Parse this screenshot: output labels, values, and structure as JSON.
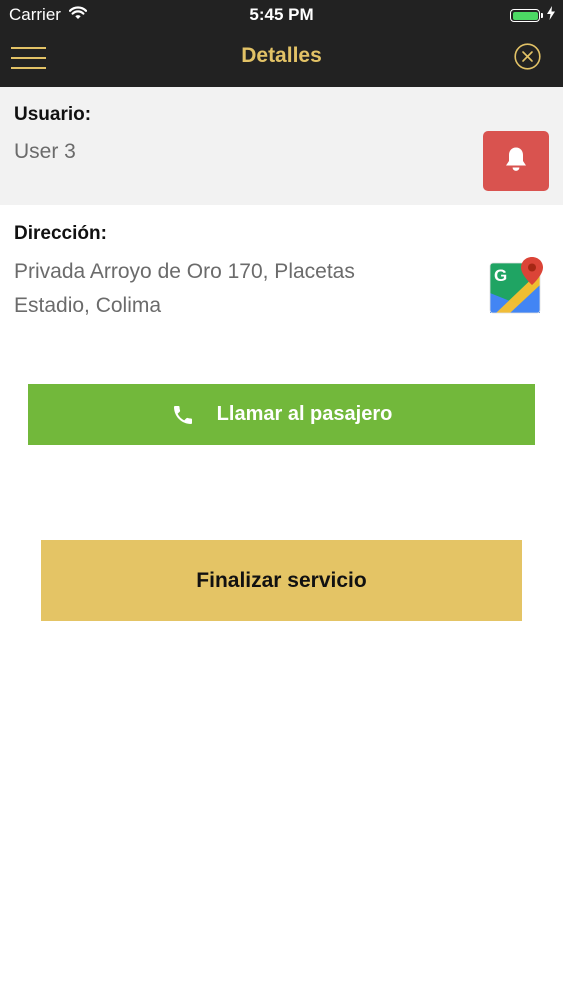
{
  "status_bar": {
    "carrier": "Carrier",
    "time": "5:45 PM",
    "battery_level": 1.0,
    "icons": [
      "wifi-icon",
      "battery-icon",
      "charging-bolt-icon"
    ]
  },
  "nav": {
    "title": "Detalles",
    "left_icon": "hamburger-menu-icon",
    "right_icon": "close-circle-icon"
  },
  "user": {
    "label": "Usuario:",
    "value": "User 3",
    "alert_icon": "bell-icon"
  },
  "address": {
    "label": "Dirección:",
    "value_line1": "Privada Arroyo de Oro 170, Placetas",
    "value_line2": "Estadio, Colima",
    "maps_icon": "google-maps-icon"
  },
  "actions": {
    "call_label": "Llamar al pasajero",
    "call_icon": "phone-icon",
    "finish_label": "Finalizar servicio"
  },
  "colors": {
    "bar_background": "#222222",
    "accent_gold": "#e2c266",
    "alert_red": "#d9534f",
    "call_green": "#72b83b",
    "finish_gold": "#e4c465",
    "user_section_bg": "#f2f2f2"
  }
}
